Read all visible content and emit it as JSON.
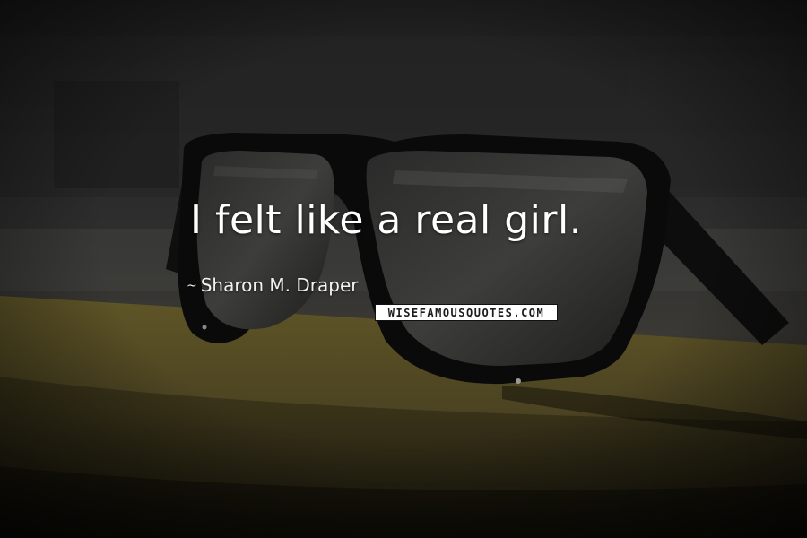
{
  "quote": {
    "text": "I felt like a real girl."
  },
  "author": {
    "prefix": "~",
    "name": "Sharon M. Draper"
  },
  "watermark": {
    "text": "WISEFAMOUSQUOTES.COM"
  },
  "background": {
    "subject": "sunglasses-image",
    "colors": {
      "sky": "#2b2b2b",
      "surface": "#5a5024",
      "frame": "#0e0e0e"
    }
  }
}
